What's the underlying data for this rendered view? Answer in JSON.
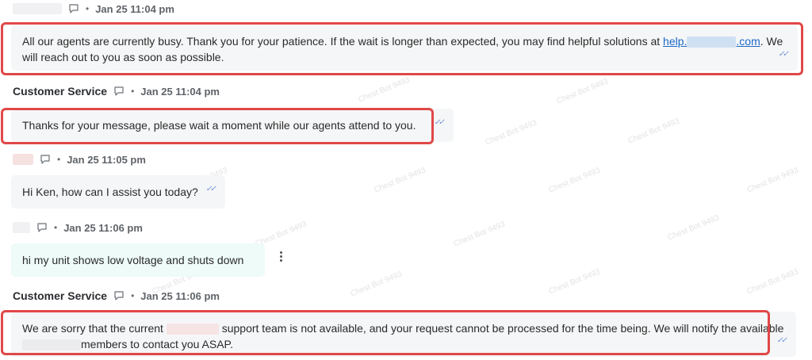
{
  "messages": [
    {
      "sender": "",
      "time": "Jan 25 11:04 pm",
      "text_part1": "All our agents are currently busy. Thank you for your patience. If the wait is longer than expected, you may find helpful solutions at ",
      "link_prefix": "help.",
      "link_suffix": ".com",
      "text_part2": ". We will reach out to you as soon as possible."
    },
    {
      "sender": "Customer Service",
      "time": "Jan 25 11:04 pm",
      "text": "Thanks for your message, please wait a moment while our agents attend to you."
    },
    {
      "sender": "",
      "time": "Jan 25 11:05 pm",
      "text": "Hi Ken, how can I assist you today?"
    },
    {
      "sender": "",
      "time": "Jan 25 11:06 pm",
      "text": "hi my unit shows low voltage and shuts down"
    },
    {
      "sender": "Customer Service",
      "time": "Jan 25 11:06 pm",
      "text_part1": "We are sorry that the current ",
      "text_part2": " support team is not available, and your request cannot be processed for the time being. We will notify the available ",
      "text_part3": "members to contact you ASAP."
    }
  ],
  "watermark_text": "Chest Bot 9493",
  "colors": {
    "highlight": "#e04848",
    "user_bubble": "#eefbf8",
    "agent_bubble": "#f5f6f7",
    "link": "#1a68c8"
  }
}
